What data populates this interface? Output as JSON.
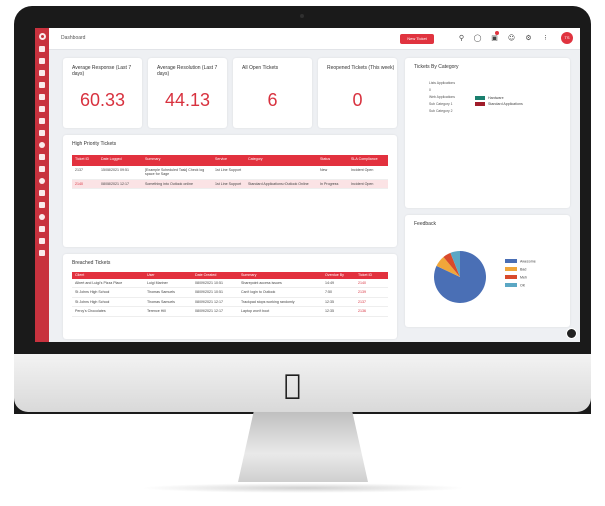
{
  "topbar": {
    "breadcrumb": "Dashboard",
    "new_button": "New Ticket",
    "icons": [
      "search-icon",
      "bell-icon",
      "message-icon",
      "users-icon",
      "settings-icon",
      "pin-icon"
    ],
    "avatar_initials": "TS"
  },
  "colors": {
    "accent": "#e0333f",
    "sidebar": "#c8323e",
    "pie_blue": "#4a6fb5",
    "pie_orange": "#f0a63a",
    "pie_red": "#d94a2b",
    "pie_teal": "#5ba7c4"
  },
  "kpis": [
    {
      "title": "Average Response (Last 7 days)",
      "value": "60.33"
    },
    {
      "title": "Average Resolution (Last 7 days)",
      "value": "44.13"
    },
    {
      "title": "All Open Tickets",
      "value": "6"
    },
    {
      "title": "Reopened Tickets (This week)",
      "value": "0"
    }
  ],
  "category_panel": {
    "title": "Tickets By Category",
    "labels": [
      "Lists Applications",
      "0",
      "Web Applications",
      "Sub Category 1",
      "Sub Category 2"
    ],
    "legend": [
      "Hardware",
      "Standard Applications"
    ]
  },
  "high_priority": {
    "title": "High Priority Tickets",
    "columns": [
      "Ticket ID",
      "Date Logged",
      "Summary",
      "Service",
      "Category",
      "Status",
      "SLA Compliance"
    ],
    "rows": [
      [
        "2137",
        "15/08/2021 09:51",
        "[Example Scheduled Task] Check log space for Sage",
        "1st Line Support",
        "",
        "New",
        "Incident Open"
      ],
      [
        "2140",
        "08/08/2021 12:17",
        "Something into Outlook online",
        "1st Line Support",
        "Standard Applications>Outlook Online",
        "In Progress",
        "Incident Open"
      ]
    ]
  },
  "breached": {
    "title": "Breached Tickets",
    "columns": [
      "Client",
      "User",
      "Date Created",
      "Summary",
      "Overdue By",
      "Ticket ID"
    ],
    "rows": [
      [
        "Albert and Luigi's Pizza Place",
        "Luigi Mariner",
        "08/09/2021 10:51",
        "Sharepoint access issues",
        "14:49",
        "2140"
      ],
      [
        "St Johns High School",
        "Thomas Samuels",
        "08/09/2021 10:51",
        "Can't login to Outlook",
        "7:50",
        "2139"
      ],
      [
        "St Johns High School",
        "Thomas Samuels",
        "08/09/2021 12:17",
        "Trackpad stops working randomly",
        "12:35",
        "2137"
      ],
      [
        "Percy's Chocolates",
        "Terence Hill",
        "08/09/2021 12:17",
        "Laptop won't boot",
        "12:35",
        "2136"
      ]
    ]
  },
  "feedback": {
    "title": "Feedback"
  },
  "chart_data": {
    "type": "pie",
    "categories": [
      "Awesome",
      "Bad",
      "Meh",
      "OK"
    ],
    "values": [
      82,
      7,
      5,
      6
    ],
    "colors": [
      "#4a6fb5",
      "#f0a63a",
      "#d94a2b",
      "#5ba7c4"
    ],
    "legend_position": "right"
  }
}
